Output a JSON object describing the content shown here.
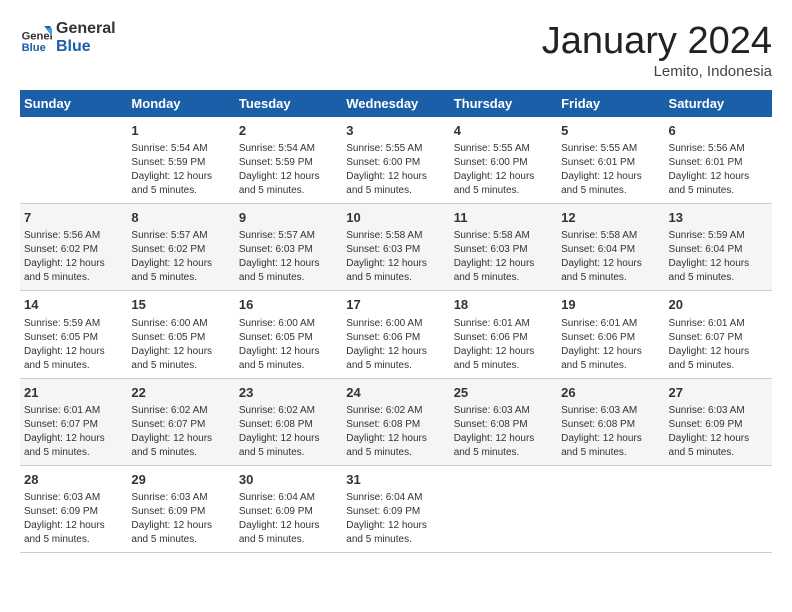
{
  "header": {
    "logo_general": "General",
    "logo_blue": "Blue",
    "month_title": "January 2024",
    "location": "Lemito, Indonesia"
  },
  "weekdays": [
    "Sunday",
    "Monday",
    "Tuesday",
    "Wednesday",
    "Thursday",
    "Friday",
    "Saturday"
  ],
  "weeks": [
    [
      {
        "day": "",
        "info": ""
      },
      {
        "day": "1",
        "info": "Sunrise: 5:54 AM\nSunset: 5:59 PM\nDaylight: 12 hours\nand 5 minutes."
      },
      {
        "day": "2",
        "info": "Sunrise: 5:54 AM\nSunset: 5:59 PM\nDaylight: 12 hours\nand 5 minutes."
      },
      {
        "day": "3",
        "info": "Sunrise: 5:55 AM\nSunset: 6:00 PM\nDaylight: 12 hours\nand 5 minutes."
      },
      {
        "day": "4",
        "info": "Sunrise: 5:55 AM\nSunset: 6:00 PM\nDaylight: 12 hours\nand 5 minutes."
      },
      {
        "day": "5",
        "info": "Sunrise: 5:55 AM\nSunset: 6:01 PM\nDaylight: 12 hours\nand 5 minutes."
      },
      {
        "day": "6",
        "info": "Sunrise: 5:56 AM\nSunset: 6:01 PM\nDaylight: 12 hours\nand 5 minutes."
      }
    ],
    [
      {
        "day": "7",
        "info": "Sunrise: 5:56 AM\nSunset: 6:02 PM\nDaylight: 12 hours\nand 5 minutes."
      },
      {
        "day": "8",
        "info": "Sunrise: 5:57 AM\nSunset: 6:02 PM\nDaylight: 12 hours\nand 5 minutes."
      },
      {
        "day": "9",
        "info": "Sunrise: 5:57 AM\nSunset: 6:03 PM\nDaylight: 12 hours\nand 5 minutes."
      },
      {
        "day": "10",
        "info": "Sunrise: 5:58 AM\nSunset: 6:03 PM\nDaylight: 12 hours\nand 5 minutes."
      },
      {
        "day": "11",
        "info": "Sunrise: 5:58 AM\nSunset: 6:03 PM\nDaylight: 12 hours\nand 5 minutes."
      },
      {
        "day": "12",
        "info": "Sunrise: 5:58 AM\nSunset: 6:04 PM\nDaylight: 12 hours\nand 5 minutes."
      },
      {
        "day": "13",
        "info": "Sunrise: 5:59 AM\nSunset: 6:04 PM\nDaylight: 12 hours\nand 5 minutes."
      }
    ],
    [
      {
        "day": "14",
        "info": "Sunrise: 5:59 AM\nSunset: 6:05 PM\nDaylight: 12 hours\nand 5 minutes."
      },
      {
        "day": "15",
        "info": "Sunrise: 6:00 AM\nSunset: 6:05 PM\nDaylight: 12 hours\nand 5 minutes."
      },
      {
        "day": "16",
        "info": "Sunrise: 6:00 AM\nSunset: 6:05 PM\nDaylight: 12 hours\nand 5 minutes."
      },
      {
        "day": "17",
        "info": "Sunrise: 6:00 AM\nSunset: 6:06 PM\nDaylight: 12 hours\nand 5 minutes."
      },
      {
        "day": "18",
        "info": "Sunrise: 6:01 AM\nSunset: 6:06 PM\nDaylight: 12 hours\nand 5 minutes."
      },
      {
        "day": "19",
        "info": "Sunrise: 6:01 AM\nSunset: 6:06 PM\nDaylight: 12 hours\nand 5 minutes."
      },
      {
        "day": "20",
        "info": "Sunrise: 6:01 AM\nSunset: 6:07 PM\nDaylight: 12 hours\nand 5 minutes."
      }
    ],
    [
      {
        "day": "21",
        "info": "Sunrise: 6:01 AM\nSunset: 6:07 PM\nDaylight: 12 hours\nand 5 minutes."
      },
      {
        "day": "22",
        "info": "Sunrise: 6:02 AM\nSunset: 6:07 PM\nDaylight: 12 hours\nand 5 minutes."
      },
      {
        "day": "23",
        "info": "Sunrise: 6:02 AM\nSunset: 6:08 PM\nDaylight: 12 hours\nand 5 minutes."
      },
      {
        "day": "24",
        "info": "Sunrise: 6:02 AM\nSunset: 6:08 PM\nDaylight: 12 hours\nand 5 minutes."
      },
      {
        "day": "25",
        "info": "Sunrise: 6:03 AM\nSunset: 6:08 PM\nDaylight: 12 hours\nand 5 minutes."
      },
      {
        "day": "26",
        "info": "Sunrise: 6:03 AM\nSunset: 6:08 PM\nDaylight: 12 hours\nand 5 minutes."
      },
      {
        "day": "27",
        "info": "Sunrise: 6:03 AM\nSunset: 6:09 PM\nDaylight: 12 hours\nand 5 minutes."
      }
    ],
    [
      {
        "day": "28",
        "info": "Sunrise: 6:03 AM\nSunset: 6:09 PM\nDaylight: 12 hours\nand 5 minutes."
      },
      {
        "day": "29",
        "info": "Sunrise: 6:03 AM\nSunset: 6:09 PM\nDaylight: 12 hours\nand 5 minutes."
      },
      {
        "day": "30",
        "info": "Sunrise: 6:04 AM\nSunset: 6:09 PM\nDaylight: 12 hours\nand 5 minutes."
      },
      {
        "day": "31",
        "info": "Sunrise: 6:04 AM\nSunset: 6:09 PM\nDaylight: 12 hours\nand 5 minutes."
      },
      {
        "day": "",
        "info": ""
      },
      {
        "day": "",
        "info": ""
      },
      {
        "day": "",
        "info": ""
      }
    ]
  ]
}
